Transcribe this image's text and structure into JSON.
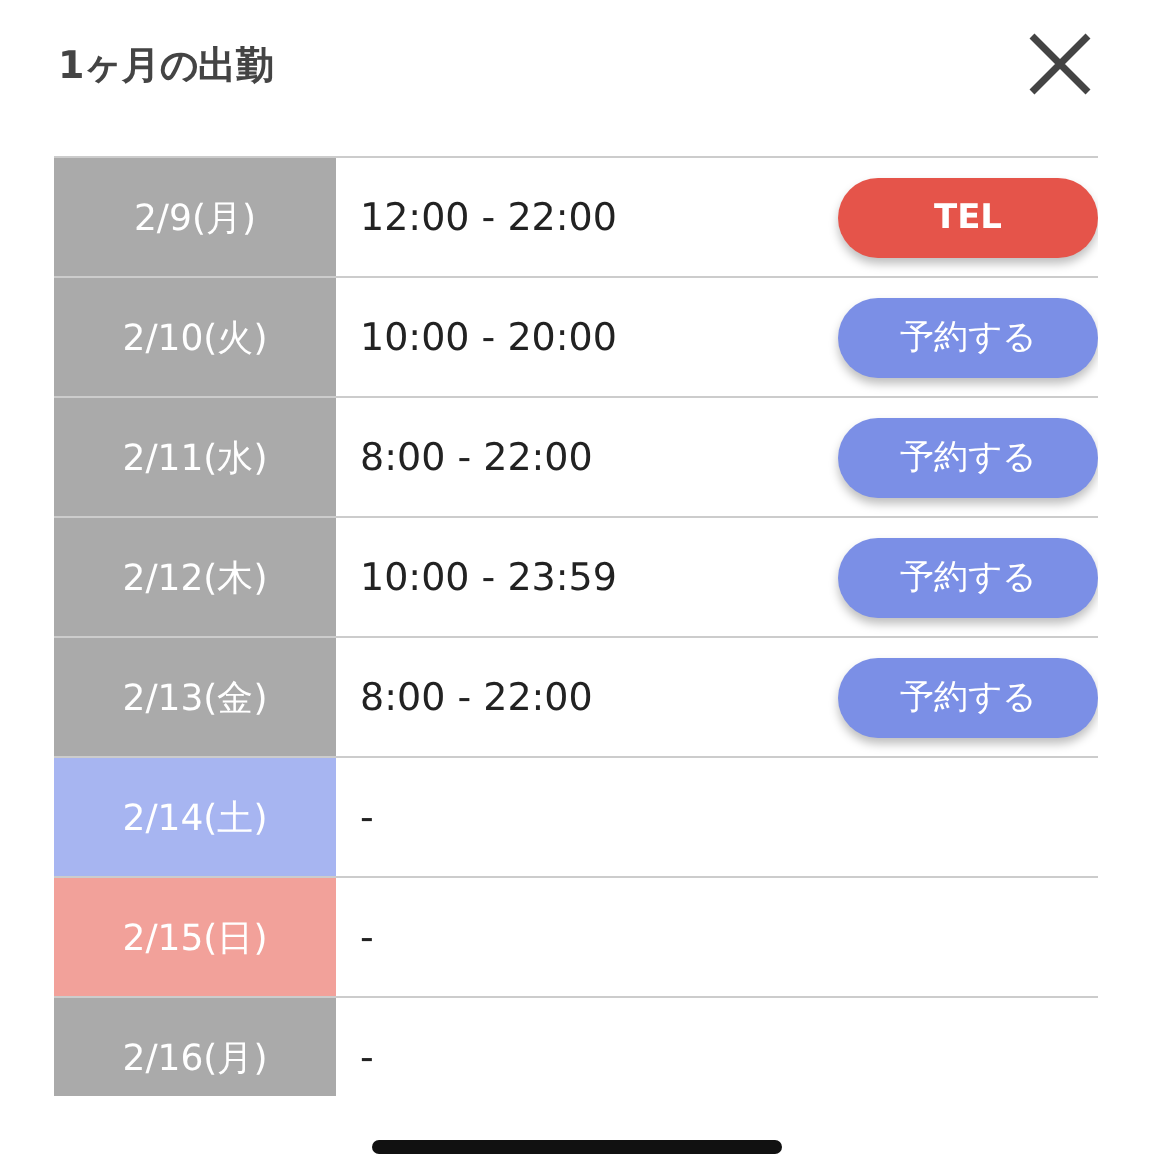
{
  "title": "1ヶ月の出勤",
  "rows": [
    {
      "date": "2/9(月)",
      "color": "#aaaaaa",
      "hours": "12:00 - 22:00",
      "button": {
        "kind": "tel",
        "label": "TEL"
      }
    },
    {
      "date": "2/10(火)",
      "color": "#aaaaaa",
      "hours": "10:00 - 20:00",
      "button": {
        "kind": "reserve",
        "label": "予約する"
      }
    },
    {
      "date": "2/11(水)",
      "color": "#aaaaaa",
      "hours": "8:00 - 22:00",
      "button": {
        "kind": "reserve",
        "label": "予約する"
      }
    },
    {
      "date": "2/12(木)",
      "color": "#aaaaaa",
      "hours": "10:00 - 23:59",
      "button": {
        "kind": "reserve",
        "label": "予約する"
      }
    },
    {
      "date": "2/13(金)",
      "color": "#aaaaaa",
      "hours": "8:00 - 22:00",
      "button": {
        "kind": "reserve",
        "label": "予約する"
      }
    },
    {
      "date": "2/14(土)",
      "color": "#a7b5f1",
      "hours": "-"
    },
    {
      "date": "2/15(日)",
      "color": "#f2a19a",
      "hours": "-"
    },
    {
      "date": "2/16(月)",
      "color": "#aaaaaa",
      "hours": "-"
    }
  ]
}
